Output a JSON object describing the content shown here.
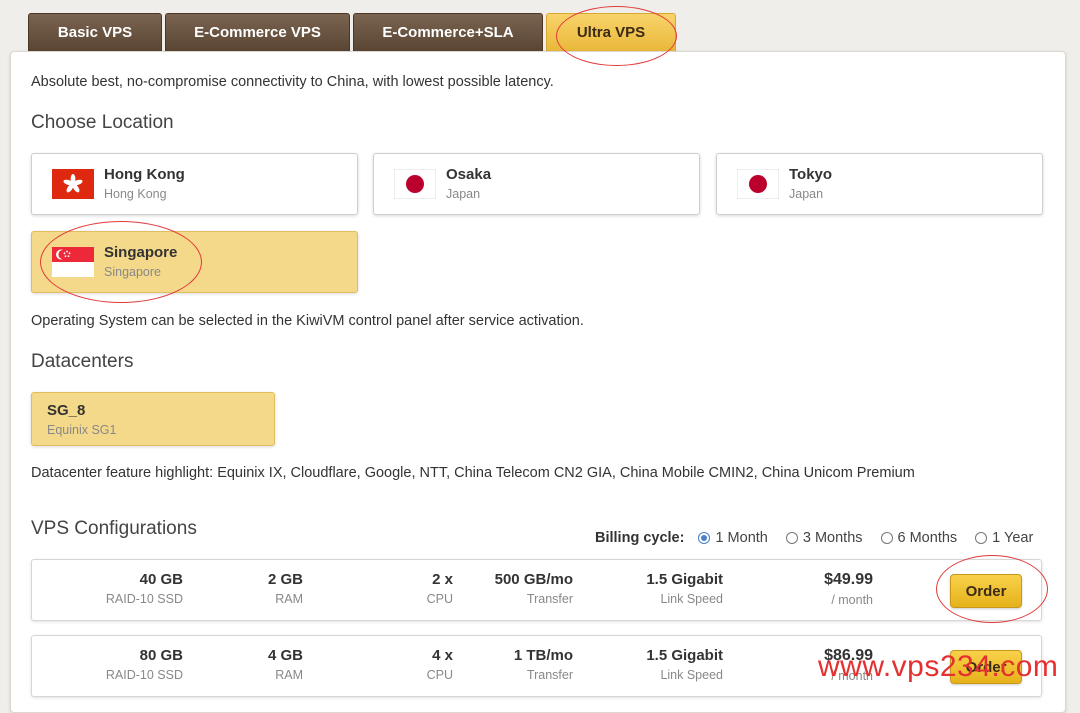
{
  "tabs": [
    {
      "label": "Basic VPS"
    },
    {
      "label": "E-Commerce VPS"
    },
    {
      "label": "E-Commerce+SLA"
    },
    {
      "label": "Ultra VPS"
    }
  ],
  "description": "Absolute best, no-compromise connectivity to China, with lowest possible latency.",
  "location_heading": "Choose Location",
  "locations": [
    {
      "name": "Hong Kong",
      "sub": "Hong Kong",
      "flag": "hong-kong-flag-icon"
    },
    {
      "name": "Osaka",
      "sub": "Japan",
      "flag": "japan-flag-icon"
    },
    {
      "name": "Tokyo",
      "sub": "Japan",
      "flag": "japan-flag-icon"
    },
    {
      "name": "Singapore",
      "sub": "Singapore",
      "flag": "singapore-flag-icon"
    }
  ],
  "os_note": "Operating System can be selected in the KiwiVM control panel after service activation.",
  "datacenters_heading": "Datacenters",
  "datacenter": {
    "name": "SG_8",
    "sub": "Equinix SG1"
  },
  "datacenter_highlight": "Datacenter feature highlight: Equinix IX, Cloudflare, Google, NTT, China Telecom CN2 GIA, China Mobile CMIN2, China Unicom Premium",
  "configs_heading": "VPS Configurations",
  "billing": {
    "label": "Billing cycle:",
    "options": [
      "1 Month",
      "3 Months",
      "6 Months",
      "1 Year"
    ],
    "selected": "1 Month"
  },
  "configs": [
    {
      "disk": "40 GB",
      "disk_u": "RAID-10 SSD",
      "ram": "2 GB",
      "ram_u": "RAM",
      "cpu": "2 x",
      "cpu_u": "CPU",
      "transfer": "500 GB/mo",
      "transfer_u": "Transfer",
      "link": "1.5 Gigabit",
      "link_u": "Link Speed",
      "price": "$49.99",
      "price_u": "/ month",
      "order": "Order"
    },
    {
      "disk": "80 GB",
      "disk_u": "RAID-10 SSD",
      "ram": "4 GB",
      "ram_u": "RAM",
      "cpu": "4 x",
      "cpu_u": "CPU",
      "transfer": "1 TB/mo",
      "transfer_u": "Transfer",
      "link": "1.5 Gigabit",
      "link_u": "Link Speed",
      "price": "$86.99",
      "price_u": "/ month",
      "order": "Order"
    }
  ],
  "watermark": "www.vps234.com",
  "colors": {
    "accent": "#f5d98a",
    "tab_dark": "#5a4534",
    "annotation": "#e23a3a",
    "radio": "#4a7fc9"
  }
}
